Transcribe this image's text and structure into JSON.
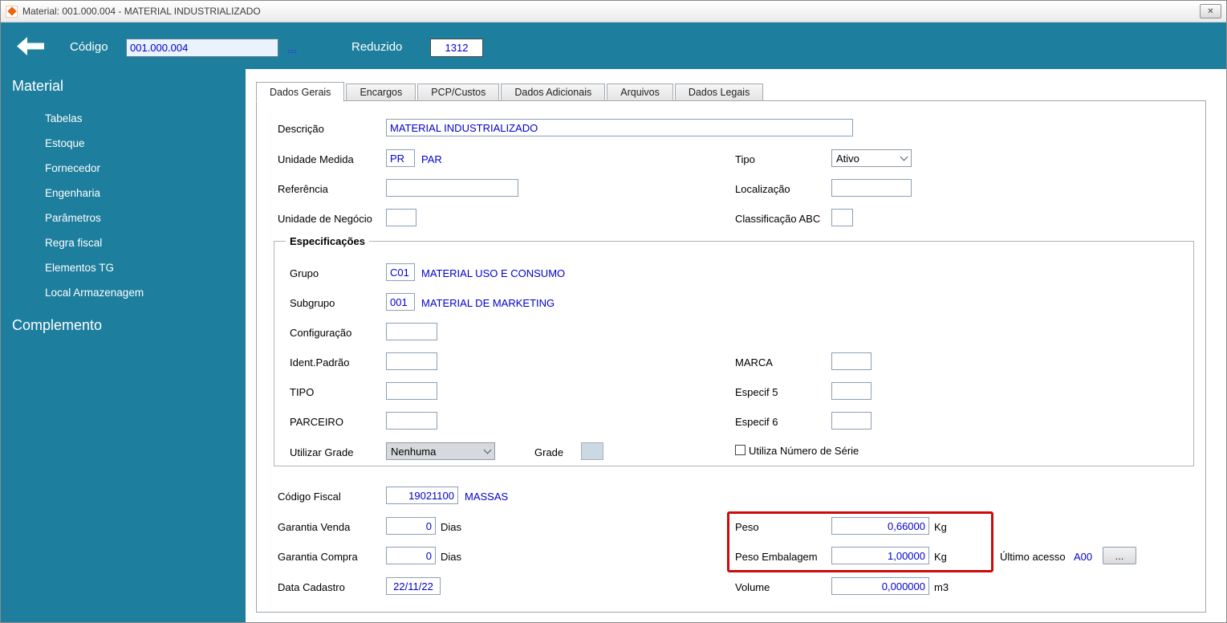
{
  "window": {
    "title": "Material: 001.000.004 - MATERIAL INDUSTRIALIZADO",
    "close_icon": "✕"
  },
  "header": {
    "codigo_label": "Código",
    "codigo_value": "001.000.004",
    "more_link": "...",
    "reduzido_label": "Reduzido",
    "reduzido_value": "1312"
  },
  "sidebar": {
    "material_title": "Material",
    "material_items": [
      "Tabelas",
      "Estoque",
      "Fornecedor",
      "Engenharia",
      "Parâmetros",
      "Regra fiscal",
      "Elementos TG",
      "Local Armazenagem"
    ],
    "complemento_title": "Complemento"
  },
  "tabs": [
    {
      "label": "Dados Gerais",
      "active": true
    },
    {
      "label": "Encargos",
      "active": false
    },
    {
      "label": "PCP/Custos",
      "active": false
    },
    {
      "label": "Dados Adicionais",
      "active": false
    },
    {
      "label": "Arquivos",
      "active": false
    },
    {
      "label": "Dados Legais",
      "active": false
    }
  ],
  "fields": {
    "descricao": {
      "label": "Descrição",
      "value": "MATERIAL INDUSTRIALIZADO"
    },
    "unidade_medida": {
      "label": "Unidade Medida",
      "value": "PR",
      "description": "PAR"
    },
    "tipo": {
      "label": "Tipo",
      "value": "Ativo"
    },
    "referencia": {
      "label": "Referência",
      "value": ""
    },
    "localizacao": {
      "label": "Localização",
      "value": ""
    },
    "unidade_negocio": {
      "label": "Unidade de Negócio",
      "value": ""
    },
    "classificacao_abc": {
      "label": "Classificação ABC",
      "value": ""
    },
    "especificacoes_title": "Especificações",
    "grupo": {
      "label": "Grupo",
      "value": "C01",
      "description": "MATERIAL USO E CONSUMO"
    },
    "subgrupo": {
      "label": "Subgrupo",
      "value": "001",
      "description": "MATERIAL DE MARKETING"
    },
    "configuracao": {
      "label": "Configuração",
      "value": ""
    },
    "ident_padrao": {
      "label": "Ident.Padrão",
      "value": ""
    },
    "marca": {
      "label": "MARCA",
      "value": ""
    },
    "tipo_especif": {
      "label": "TIPO",
      "value": ""
    },
    "especif5": {
      "label": "Especif 5",
      "value": ""
    },
    "parceiro": {
      "label": "PARCEIRO",
      "value": ""
    },
    "especif6": {
      "label": "Especif 6",
      "value": ""
    },
    "utilizar_grade": {
      "label": "Utilizar Grade",
      "value": "Nenhuma"
    },
    "grade": {
      "label": "Grade",
      "value": ""
    },
    "utiliza_numero_serie": {
      "label": "Utiliza Número de Série",
      "checked": false
    },
    "codigo_fiscal": {
      "label": "Código Fiscal",
      "value": "19021100",
      "description": "MASSAS"
    },
    "garantia_venda": {
      "label": "Garantia Venda",
      "value": "0",
      "suffix": "Dias"
    },
    "garantia_compra": {
      "label": "Garantia Compra",
      "value": "0",
      "suffix": "Dias"
    },
    "data_cadastro": {
      "label": "Data Cadastro",
      "value": "22/11/22"
    },
    "peso": {
      "label": "Peso",
      "value": "0,66000",
      "suffix": "Kg"
    },
    "peso_embalagem": {
      "label": "Peso Embalagem",
      "value": "1,00000",
      "suffix": "Kg"
    },
    "volume": {
      "label": "Volume",
      "value": "0,000000",
      "suffix": "m3"
    },
    "ultimo_acesso": {
      "label": "Último acesso",
      "value": "A00",
      "button": "..."
    }
  },
  "colors": {
    "teal": "#1d7e9d",
    "value_text": "#0000cc",
    "highlight": "#cc0b0b"
  }
}
